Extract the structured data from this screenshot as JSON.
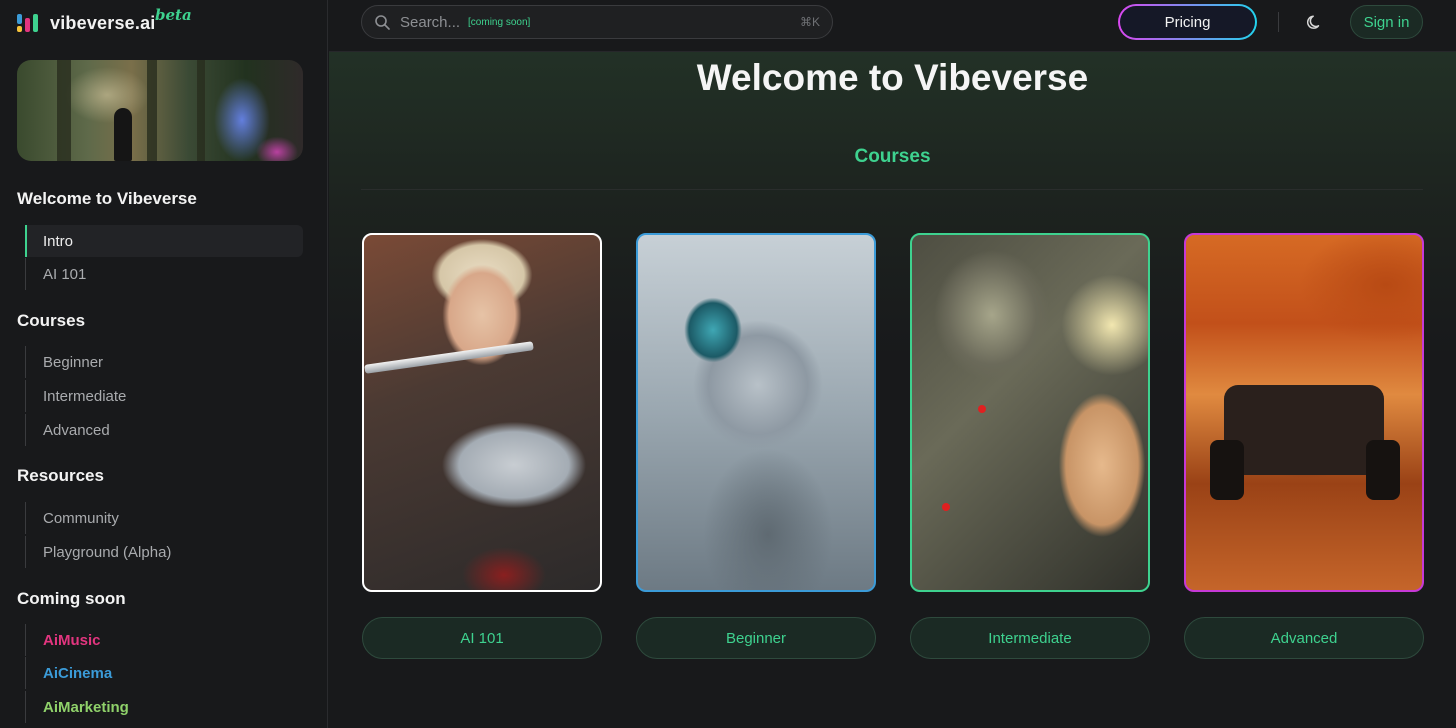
{
  "app": {
    "name": "vibeverse.ai",
    "badge": "beta"
  },
  "header": {
    "search_placeholder": "Search...",
    "search_note": "[coming soon]",
    "search_shortcut": "⌘K",
    "pricing_label": "Pricing",
    "signin_label": "Sign in"
  },
  "sidebar": {
    "sections": [
      {
        "title": "Welcome to Vibeverse",
        "items": [
          "Intro",
          "AI 101"
        ]
      },
      {
        "title": "Courses",
        "items": [
          "Beginner",
          "Intermediate",
          "Advanced"
        ]
      },
      {
        "title": "Resources",
        "items": [
          "Community",
          "Playground (Alpha)"
        ]
      },
      {
        "title": "Coming soon",
        "items": [
          "AiMusic",
          "AiCinema",
          "AiMarketing"
        ]
      }
    ],
    "active_item": "Intro",
    "coming_soon_colors": {
      "AiMusic": "#e2357f",
      "AiCinema": "#3b9bd8",
      "AiMarketing": "#8fd16a"
    }
  },
  "main": {
    "title": "Welcome to Vibeverse",
    "section_title": "Courses",
    "cards": [
      {
        "label": "AI 101",
        "border": "#ffffff"
      },
      {
        "label": "Beginner",
        "border": "#3b9bd8"
      },
      {
        "label": "Intermediate",
        "border": "#3ed28f"
      },
      {
        "label": "Advanced",
        "border": "#c639d6"
      }
    ]
  },
  "colors": {
    "accent": "#3ed28f",
    "background": "#18191b"
  }
}
